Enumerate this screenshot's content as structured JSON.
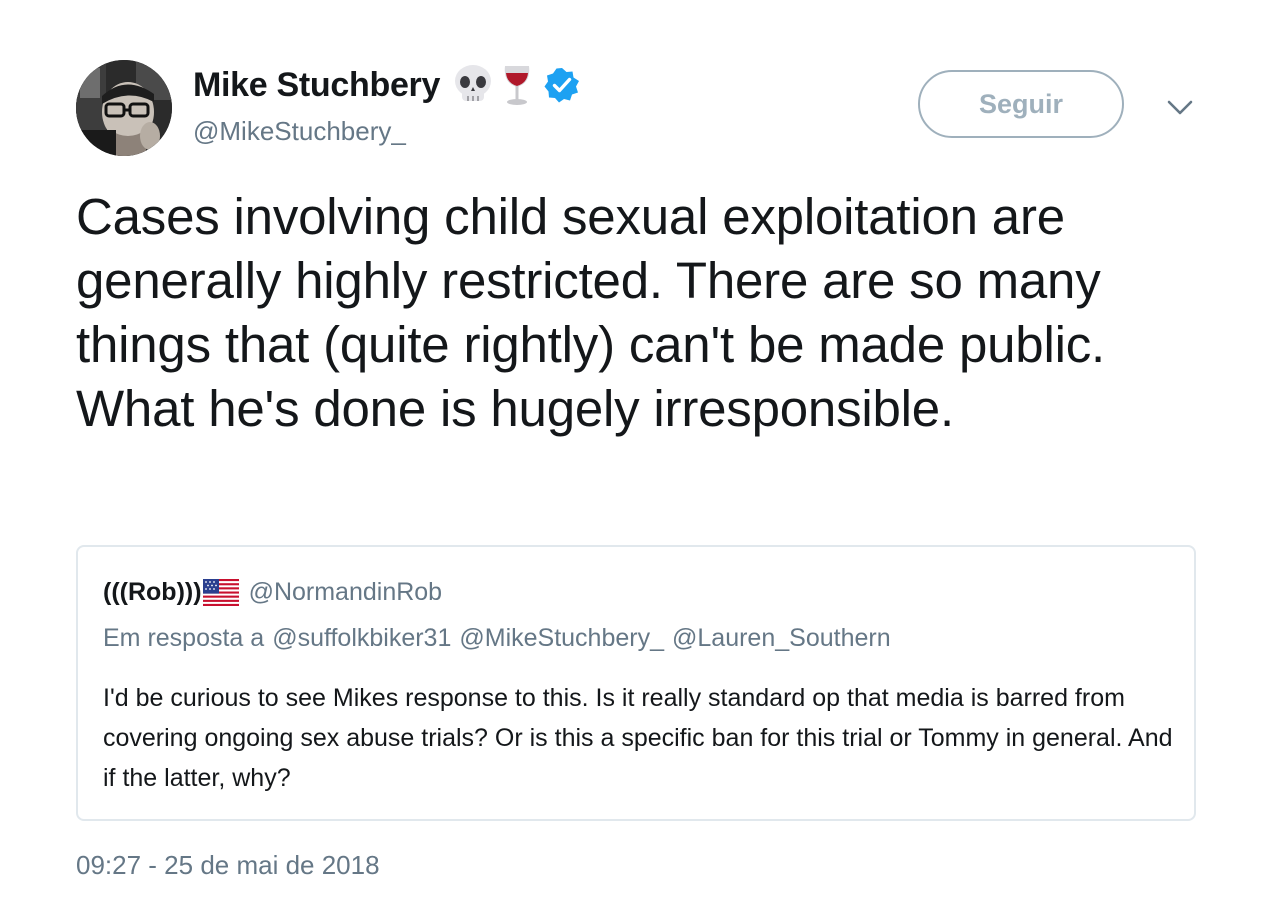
{
  "author": {
    "display_name": "Mike Stuchbery",
    "handle": "@MikeStuchbery_",
    "emojis": [
      "skull-emoji",
      "wine-glass-emoji"
    ],
    "verified": true
  },
  "follow_button": {
    "label": "Seguir"
  },
  "tweet": {
    "text": "Cases involving child sexual exploitation are generally highly restricted. There are so many things that (quite rightly) can't be made public. What he's done is hugely irresponsible."
  },
  "quoted": {
    "display_name": "(((Rob)))",
    "flag": "us-flag-emoji",
    "handle": "@NormandinRob",
    "reply_prefix": "Em resposta a",
    "reply_handles": [
      "@suffolkbiker31",
      "@MikeStuchbery_",
      "@Lauren_Southern"
    ],
    "text": "I'd be curious to see Mikes response to this. Is it really standard op that media is barred from covering ongoing sex abuse trials? Or is this a specific ban for this trial or Tommy in general. And if the latter, why?"
  },
  "timestamp": "09:27 - 25 de mai de 2018",
  "colors": {
    "text_primary": "#14171a",
    "text_secondary": "#657786",
    "verified_blue": "#1da1f2",
    "button_border": "#9fb0bc",
    "card_border": "#e1e8ed"
  }
}
